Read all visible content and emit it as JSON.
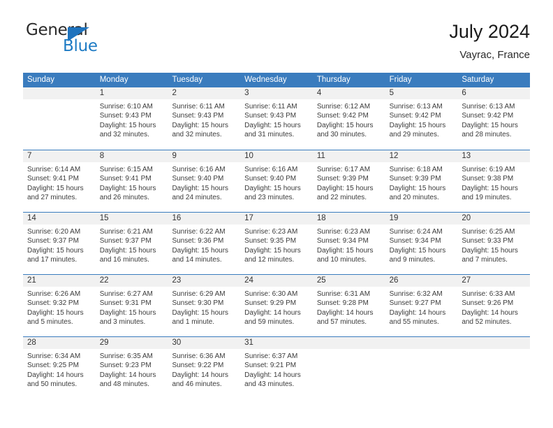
{
  "brand": {
    "name_part1": "General",
    "name_part2": "Blue",
    "triangle_color": "#1e73be",
    "text_color": "#2b2b2b",
    "blue_color": "#1e7bc4"
  },
  "header": {
    "title": "July 2024",
    "subtitle": "Vayrac, France"
  },
  "theme": {
    "header_blue": "#3a7cbe",
    "daynum_band": "#f1f1f1",
    "body_text": "#3b3b3b"
  },
  "weekdays": [
    "Sunday",
    "Monday",
    "Tuesday",
    "Wednesday",
    "Thursday",
    "Friday",
    "Saturday"
  ],
  "weeks": [
    [
      {
        "day": "",
        "sunrise": "",
        "sunset": "",
        "daylight_1": "",
        "daylight_2": ""
      },
      {
        "day": "1",
        "sunrise": "Sunrise: 6:10 AM",
        "sunset": "Sunset: 9:43 PM",
        "daylight_1": "Daylight: 15 hours",
        "daylight_2": "and 32 minutes."
      },
      {
        "day": "2",
        "sunrise": "Sunrise: 6:11 AM",
        "sunset": "Sunset: 9:43 PM",
        "daylight_1": "Daylight: 15 hours",
        "daylight_2": "and 32 minutes."
      },
      {
        "day": "3",
        "sunrise": "Sunrise: 6:11 AM",
        "sunset": "Sunset: 9:43 PM",
        "daylight_1": "Daylight: 15 hours",
        "daylight_2": "and 31 minutes."
      },
      {
        "day": "4",
        "sunrise": "Sunrise: 6:12 AM",
        "sunset": "Sunset: 9:42 PM",
        "daylight_1": "Daylight: 15 hours",
        "daylight_2": "and 30 minutes."
      },
      {
        "day": "5",
        "sunrise": "Sunrise: 6:13 AM",
        "sunset": "Sunset: 9:42 PM",
        "daylight_1": "Daylight: 15 hours",
        "daylight_2": "and 29 minutes."
      },
      {
        "day": "6",
        "sunrise": "Sunrise: 6:13 AM",
        "sunset": "Sunset: 9:42 PM",
        "daylight_1": "Daylight: 15 hours",
        "daylight_2": "and 28 minutes."
      }
    ],
    [
      {
        "day": "7",
        "sunrise": "Sunrise: 6:14 AM",
        "sunset": "Sunset: 9:41 PM",
        "daylight_1": "Daylight: 15 hours",
        "daylight_2": "and 27 minutes."
      },
      {
        "day": "8",
        "sunrise": "Sunrise: 6:15 AM",
        "sunset": "Sunset: 9:41 PM",
        "daylight_1": "Daylight: 15 hours",
        "daylight_2": "and 26 minutes."
      },
      {
        "day": "9",
        "sunrise": "Sunrise: 6:16 AM",
        "sunset": "Sunset: 9:40 PM",
        "daylight_1": "Daylight: 15 hours",
        "daylight_2": "and 24 minutes."
      },
      {
        "day": "10",
        "sunrise": "Sunrise: 6:16 AM",
        "sunset": "Sunset: 9:40 PM",
        "daylight_1": "Daylight: 15 hours",
        "daylight_2": "and 23 minutes."
      },
      {
        "day": "11",
        "sunrise": "Sunrise: 6:17 AM",
        "sunset": "Sunset: 9:39 PM",
        "daylight_1": "Daylight: 15 hours",
        "daylight_2": "and 22 minutes."
      },
      {
        "day": "12",
        "sunrise": "Sunrise: 6:18 AM",
        "sunset": "Sunset: 9:39 PM",
        "daylight_1": "Daylight: 15 hours",
        "daylight_2": "and 20 minutes."
      },
      {
        "day": "13",
        "sunrise": "Sunrise: 6:19 AM",
        "sunset": "Sunset: 9:38 PM",
        "daylight_1": "Daylight: 15 hours",
        "daylight_2": "and 19 minutes."
      }
    ],
    [
      {
        "day": "14",
        "sunrise": "Sunrise: 6:20 AM",
        "sunset": "Sunset: 9:37 PM",
        "daylight_1": "Daylight: 15 hours",
        "daylight_2": "and 17 minutes."
      },
      {
        "day": "15",
        "sunrise": "Sunrise: 6:21 AM",
        "sunset": "Sunset: 9:37 PM",
        "daylight_1": "Daylight: 15 hours",
        "daylight_2": "and 16 minutes."
      },
      {
        "day": "16",
        "sunrise": "Sunrise: 6:22 AM",
        "sunset": "Sunset: 9:36 PM",
        "daylight_1": "Daylight: 15 hours",
        "daylight_2": "and 14 minutes."
      },
      {
        "day": "17",
        "sunrise": "Sunrise: 6:23 AM",
        "sunset": "Sunset: 9:35 PM",
        "daylight_1": "Daylight: 15 hours",
        "daylight_2": "and 12 minutes."
      },
      {
        "day": "18",
        "sunrise": "Sunrise: 6:23 AM",
        "sunset": "Sunset: 9:34 PM",
        "daylight_1": "Daylight: 15 hours",
        "daylight_2": "and 10 minutes."
      },
      {
        "day": "19",
        "sunrise": "Sunrise: 6:24 AM",
        "sunset": "Sunset: 9:34 PM",
        "daylight_1": "Daylight: 15 hours",
        "daylight_2": "and 9 minutes."
      },
      {
        "day": "20",
        "sunrise": "Sunrise: 6:25 AM",
        "sunset": "Sunset: 9:33 PM",
        "daylight_1": "Daylight: 15 hours",
        "daylight_2": "and 7 minutes."
      }
    ],
    [
      {
        "day": "21",
        "sunrise": "Sunrise: 6:26 AM",
        "sunset": "Sunset: 9:32 PM",
        "daylight_1": "Daylight: 15 hours",
        "daylight_2": "and 5 minutes."
      },
      {
        "day": "22",
        "sunrise": "Sunrise: 6:27 AM",
        "sunset": "Sunset: 9:31 PM",
        "daylight_1": "Daylight: 15 hours",
        "daylight_2": "and 3 minutes."
      },
      {
        "day": "23",
        "sunrise": "Sunrise: 6:29 AM",
        "sunset": "Sunset: 9:30 PM",
        "daylight_1": "Daylight: 15 hours",
        "daylight_2": "and 1 minute."
      },
      {
        "day": "24",
        "sunrise": "Sunrise: 6:30 AM",
        "sunset": "Sunset: 9:29 PM",
        "daylight_1": "Daylight: 14 hours",
        "daylight_2": "and 59 minutes."
      },
      {
        "day": "25",
        "sunrise": "Sunrise: 6:31 AM",
        "sunset": "Sunset: 9:28 PM",
        "daylight_1": "Daylight: 14 hours",
        "daylight_2": "and 57 minutes."
      },
      {
        "day": "26",
        "sunrise": "Sunrise: 6:32 AM",
        "sunset": "Sunset: 9:27 PM",
        "daylight_1": "Daylight: 14 hours",
        "daylight_2": "and 55 minutes."
      },
      {
        "day": "27",
        "sunrise": "Sunrise: 6:33 AM",
        "sunset": "Sunset: 9:26 PM",
        "daylight_1": "Daylight: 14 hours",
        "daylight_2": "and 52 minutes."
      }
    ],
    [
      {
        "day": "28",
        "sunrise": "Sunrise: 6:34 AM",
        "sunset": "Sunset: 9:25 PM",
        "daylight_1": "Daylight: 14 hours",
        "daylight_2": "and 50 minutes."
      },
      {
        "day": "29",
        "sunrise": "Sunrise: 6:35 AM",
        "sunset": "Sunset: 9:23 PM",
        "daylight_1": "Daylight: 14 hours",
        "daylight_2": "and 48 minutes."
      },
      {
        "day": "30",
        "sunrise": "Sunrise: 6:36 AM",
        "sunset": "Sunset: 9:22 PM",
        "daylight_1": "Daylight: 14 hours",
        "daylight_2": "and 46 minutes."
      },
      {
        "day": "31",
        "sunrise": "Sunrise: 6:37 AM",
        "sunset": "Sunset: 9:21 PM",
        "daylight_1": "Daylight: 14 hours",
        "daylight_2": "and 43 minutes."
      },
      {
        "day": "",
        "sunrise": "",
        "sunset": "",
        "daylight_1": "",
        "daylight_2": ""
      },
      {
        "day": "",
        "sunrise": "",
        "sunset": "",
        "daylight_1": "",
        "daylight_2": ""
      },
      {
        "day": "",
        "sunrise": "",
        "sunset": "",
        "daylight_1": "",
        "daylight_2": ""
      }
    ]
  ]
}
